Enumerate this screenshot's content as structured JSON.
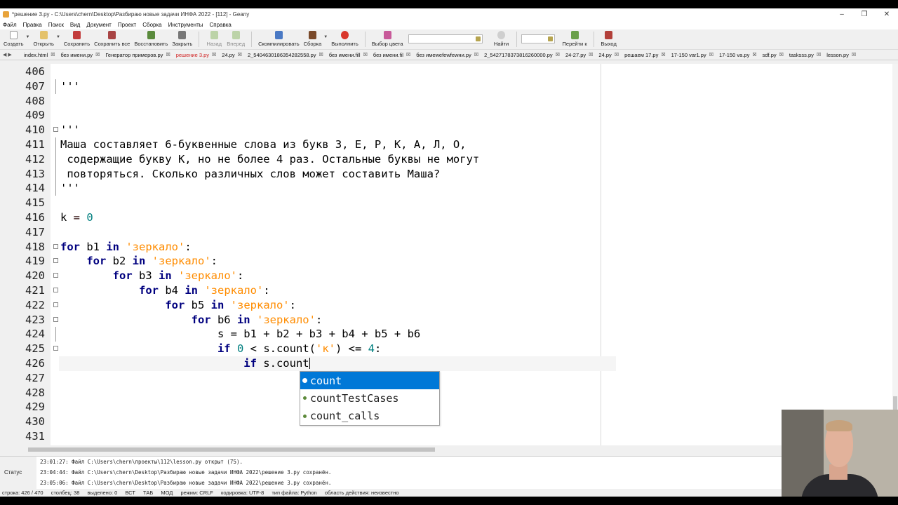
{
  "window": {
    "title": "*решение 3.py - C:\\Users\\chern\\Desktop\\Разбираю новые задачи ИНФА 2022 - [112] - Geany",
    "controls": [
      "–",
      "❐",
      "✕"
    ]
  },
  "menu": [
    "Файл",
    "Правка",
    "Поиск",
    "Вид",
    "Документ",
    "Проект",
    "Сборка",
    "Инструменты",
    "Справка"
  ],
  "toolbar": {
    "create": "Создать",
    "open": "Открыть",
    "save": "Сохранить",
    "save_all": "Сохранить все",
    "restore": "Восстановить",
    "close": "Закрыть",
    "back": "Назад",
    "forward": "Вперед",
    "compile": "Скомпилировать",
    "build": "Сборка",
    "run": "Выполнить",
    "color": "Выбор цвета",
    "find": "Найти",
    "goto": "Перейти к",
    "exit": "Выход"
  },
  "tabs": [
    {
      "label": "index.html",
      "active": false
    },
    {
      "label": "без имени.py",
      "active": false
    },
    {
      "label": "Генератор примеров.py",
      "active": false
    },
    {
      "label": "решение 3.py",
      "active": true
    },
    {
      "label": "24.py",
      "active": false
    },
    {
      "label": "2_5404630186354282558.py",
      "active": false
    },
    {
      "label": "без имени.fill",
      "active": false
    },
    {
      "label": "без имени.fil",
      "active": false
    },
    {
      "label": "без имеwefewfewни.py",
      "active": false
    },
    {
      "label": "2_5427178373816260000.py",
      "active": false
    },
    {
      "label": "24-27.py",
      "active": false
    },
    {
      "label": "24.py",
      "active": false
    },
    {
      "label": "решаем 17.py",
      "active": false
    },
    {
      "label": "17-150 var1.py",
      "active": false
    },
    {
      "label": "17-150 va.py",
      "active": false
    },
    {
      "label": "sdf.py",
      "active": false
    },
    {
      "label": "tasksss.py",
      "active": false
    },
    {
      "label": "lesson.py",
      "active": false
    }
  ],
  "code": {
    "line_numbers": [
      "406",
      "407",
      "408",
      "409",
      "410",
      "411",
      "412",
      "413",
      "414",
      "415",
      "416",
      "417",
      "418",
      "419",
      "420",
      "421",
      "422",
      "423",
      "424",
      "425",
      "426",
      "427",
      "428",
      "429",
      "430",
      "431"
    ],
    "l407": "'''",
    "l410": "'''",
    "l411": "Маша составляет 6-буквенные слова из букв З, Е, Р, К, А, Л, О,",
    "l412": " содержащие букву К, но не более 4 раз. Остальные буквы не могут",
    "l413": " повторяться. Сколько различных слов может составить Маша?",
    "l414": "'''",
    "l416_var": "k",
    "l416_op": " = ",
    "l416_val": "0",
    "kw_for": "for",
    "kw_in": "in",
    "kw_if": "if",
    "str_word": "'зеркало'",
    "colon": ":",
    "b1": " b1 ",
    "b2": " b2 ",
    "b3": " b3 ",
    "b4": " b4 ",
    "b5": " b5 ",
    "b6": " b6 ",
    "l424": "s = b1 + b2 + b3 + b4 + b5 + b6",
    "l425_zero": "0",
    "l425_mid": " < s.count(",
    "l425_str": "'к'",
    "l425_tail": ") <= ",
    "l425_four": "4",
    "l426_tail": " s.count"
  },
  "autocomplete": [
    "count",
    "countTestCases",
    "count_calls"
  ],
  "messages": {
    "tab": "Статус",
    "items": [
      "23:01:27: Файл C:\\Users\\chern\\проекты\\112\\lesson.py открыт (75).",
      "23:04:44: Файл C:\\Users\\chern\\Desktop\\Разбираю новые задачи ИНФА 2022\\решение 3.py сохранён.",
      "23:05:06: Файл C:\\Users\\chern\\Desktop\\Разбираю новые задачи ИНФА 2022\\решение 3.py сохранён."
    ]
  },
  "statusbar": [
    "строка: 426 / 470",
    "столбец: 38",
    "выделено: 0",
    "ВСТ",
    "ТАБ",
    "МОД",
    "режим: CRLF",
    "кодировка: UTF-8",
    "тип файла: Python",
    "область действия: неизвестно"
  ],
  "colors": {
    "keyword": "#00007f",
    "string": "#ff8c00",
    "docstring": "#008000",
    "number": "#007f7f",
    "selection": "#0078d7",
    "active_tab": "#d01f1f"
  }
}
